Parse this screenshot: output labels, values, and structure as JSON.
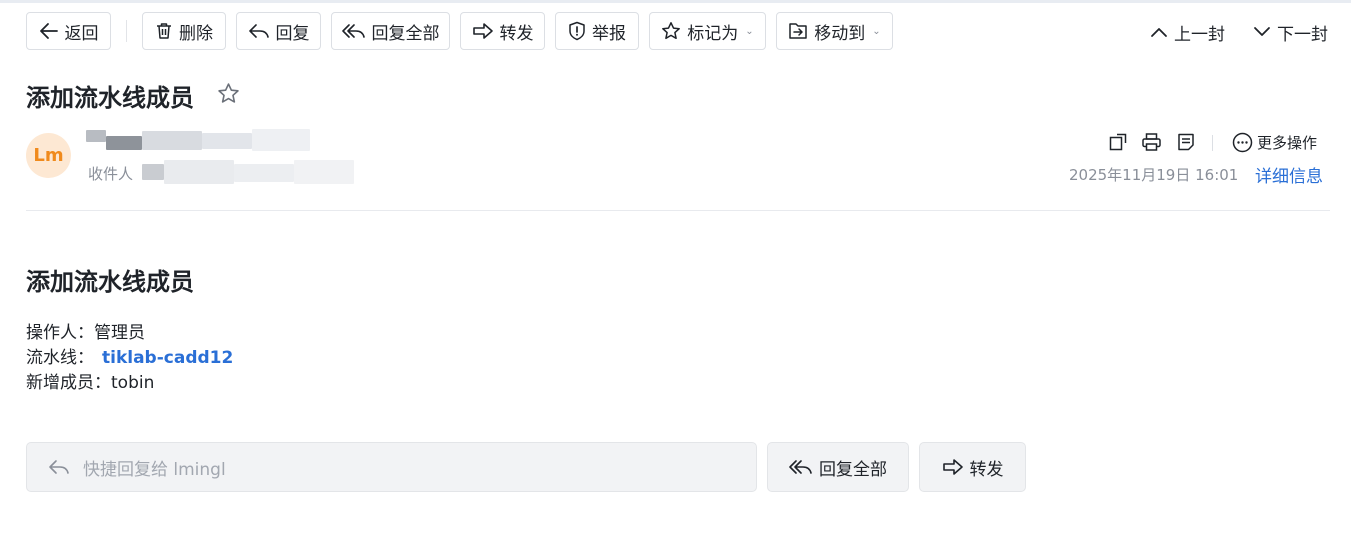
{
  "toolbar": {
    "back_label": "返回",
    "delete_label": "删除",
    "reply_label": "回复",
    "reply_all_label": "回复全部",
    "forward_label": "转发",
    "report_label": "举报",
    "mark_as_label": "标记为",
    "move_to_label": "移动到",
    "prev_label": "上一封",
    "next_label": "下一封"
  },
  "mail": {
    "subject": "添加流水线成员",
    "avatar_initials": "Lm",
    "recipient_label": "收件人",
    "date": "2025年11月19日 16:01",
    "detail_label": "详细信息",
    "more_ops_label": "更多操作"
  },
  "body": {
    "title": "添加流水线成员",
    "operator_label": "操作人：",
    "operator_value": "管理员",
    "pipeline_label": "流水线：",
    "pipeline_value": "tiklab-cadd12",
    "new_member_label": "新增成员：",
    "new_member_value": "tobin"
  },
  "footer": {
    "quick_reply_placeholder": "快捷回复给 lmingl",
    "reply_all_label": "回复全部",
    "forward_label": "转发"
  },
  "colors": {
    "link": "#2a6fd6",
    "avatar_bg": "#fde8d3",
    "avatar_text": "#f08a1c"
  },
  "icons": [
    "arrow-left-icon",
    "trash-icon",
    "reply-icon",
    "reply-all-icon",
    "forward-icon",
    "shield-icon",
    "star-icon",
    "folder-move-icon",
    "chevron-up-icon",
    "chevron-down-icon",
    "copy-window-icon",
    "printer-icon",
    "note-icon",
    "more-icon"
  ]
}
